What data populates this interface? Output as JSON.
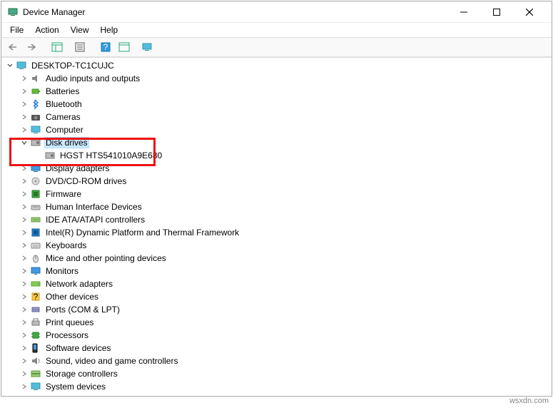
{
  "window": {
    "title": "Device Manager"
  },
  "menu": {
    "file": "File",
    "action": "Action",
    "view": "View",
    "help": "Help"
  },
  "tree": {
    "root": "DESKTOP-TC1CUJC",
    "items": [
      {
        "label": "Audio inputs and outputs",
        "expanded": false
      },
      {
        "label": "Batteries",
        "expanded": false
      },
      {
        "label": "Bluetooth",
        "expanded": false
      },
      {
        "label": "Cameras",
        "expanded": false
      },
      {
        "label": "Computer",
        "expanded": false
      },
      {
        "label": "Disk drives",
        "expanded": true,
        "selected": true,
        "children": [
          {
            "label": "HGST HTS541010A9E680"
          }
        ]
      },
      {
        "label": "Display adapters",
        "expanded": false
      },
      {
        "label": "DVD/CD-ROM drives",
        "expanded": false
      },
      {
        "label": "Firmware",
        "expanded": false
      },
      {
        "label": "Human Interface Devices",
        "expanded": false
      },
      {
        "label": "IDE ATA/ATAPI controllers",
        "expanded": false
      },
      {
        "label": "Intel(R) Dynamic Platform and Thermal Framework",
        "expanded": false
      },
      {
        "label": "Keyboards",
        "expanded": false
      },
      {
        "label": "Mice and other pointing devices",
        "expanded": false
      },
      {
        "label": "Monitors",
        "expanded": false
      },
      {
        "label": "Network adapters",
        "expanded": false
      },
      {
        "label": "Other devices",
        "expanded": false
      },
      {
        "label": "Ports (COM & LPT)",
        "expanded": false
      },
      {
        "label": "Print queues",
        "expanded": false
      },
      {
        "label": "Processors",
        "expanded": false
      },
      {
        "label": "Software devices",
        "expanded": false
      },
      {
        "label": "Sound, video and game controllers",
        "expanded": false
      },
      {
        "label": "Storage controllers",
        "expanded": false
      },
      {
        "label": "System devices",
        "expanded": false
      }
    ]
  },
  "watermark": "wsxdn.com"
}
